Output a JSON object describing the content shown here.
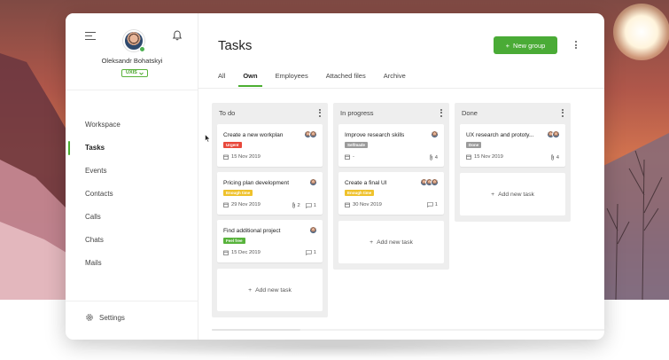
{
  "colors": {
    "accent": "#4aab36",
    "urgent": "#e8483b",
    "enough_time": "#efc22c",
    "feel_free": "#58b33c",
    "neutral": "#9b9b9b"
  },
  "user": {
    "name": "Oleksandr Bohatskyi",
    "company": "UXIS"
  },
  "sidebar": {
    "items": [
      {
        "label": "Workspace"
      },
      {
        "label": "Tasks",
        "active": true
      },
      {
        "label": "Events"
      },
      {
        "label": "Contacts"
      },
      {
        "label": "Calls"
      },
      {
        "label": "Chats"
      },
      {
        "label": "Mails"
      }
    ],
    "settings_label": "Settings"
  },
  "header": {
    "title": "Tasks",
    "new_group_label": "New group"
  },
  "tabs": [
    {
      "label": "All"
    },
    {
      "label": "Own",
      "active": true
    },
    {
      "label": "Employees"
    },
    {
      "label": "Attached files"
    },
    {
      "label": "Archive"
    }
  ],
  "columns": [
    {
      "title": "To do",
      "cards": [
        {
          "title": "Create a new workplan",
          "tag": "Urgent",
          "tag_color": "red",
          "date": "15 Nov 2019",
          "assignees": 2
        },
        {
          "title": "Pricing plan development",
          "tag": "Enough time",
          "tag_color": "yellow",
          "date": "29 Nov 2019",
          "attachments": "2",
          "comments": "1",
          "assignees": 1
        },
        {
          "title": "Find additional project",
          "tag": "Feel free",
          "tag_color": "green",
          "date": "15 Dec 2019",
          "comments": "1",
          "assignees": 1
        }
      ],
      "add_label": "Add new task"
    },
    {
      "title": "In progress",
      "cards": [
        {
          "title": "Improve research skills",
          "tag": "Selfmade",
          "tag_color": "grey",
          "date": "-",
          "attachments": "4",
          "assignees": 1
        },
        {
          "title": "Create a final UI",
          "tag": "Enough time",
          "tag_color": "yellow",
          "date": "30 Nov 2019",
          "comments": "1",
          "assignees": 3
        }
      ],
      "add_label": "Add new task"
    },
    {
      "title": "Done",
      "cards": [
        {
          "title": "UX research and prototy...",
          "tag": "Done",
          "tag_color": "grey",
          "date": "15 Nov 2019",
          "attachments": "4",
          "assignees": 2
        }
      ],
      "add_label": "Add new task"
    }
  ]
}
